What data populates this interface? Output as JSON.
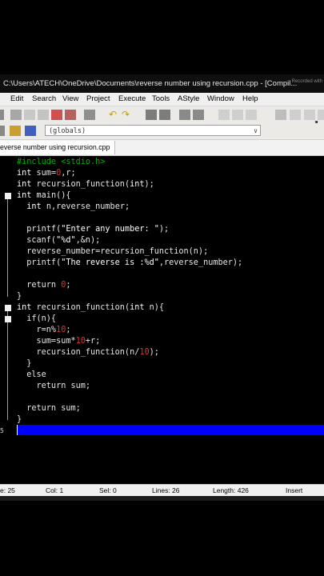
{
  "window": {
    "title": "C:\\Users\\ATECH\\OneDrive\\Documents\\reverse number using recursion.cpp - [Compil...",
    "watermark": "Recorded with"
  },
  "menu": [
    "Edit",
    "Search",
    "View",
    "Project",
    "Execute",
    "Tools",
    "AStyle",
    "Window",
    "Help"
  ],
  "scope_selector": {
    "value": "(globals)"
  },
  "tab": {
    "label": "everse number using recursion.cpp"
  },
  "code": {
    "lines": [
      [
        [
          "#include <stdio.h>",
          "pre"
        ]
      ],
      [
        [
          "int",
          "type"
        ],
        [
          " sum=",
          ""
        ],
        [
          "0",
          "num"
        ],
        [
          ",r;",
          ""
        ]
      ],
      [
        [
          "int",
          "type"
        ],
        [
          " recursion_function(",
          ""
        ],
        [
          "int",
          "type"
        ],
        [
          ");",
          ""
        ]
      ],
      [
        [
          "int",
          "type"
        ],
        [
          " main(){",
          ""
        ]
      ],
      [
        [
          "  ",
          ""
        ],
        [
          "int",
          "type"
        ],
        [
          " n,reverse_number;",
          ""
        ]
      ],
      [
        [
          "",
          ""
        ]
      ],
      [
        [
          "  printf(",
          ""
        ],
        [
          "\"Enter any number: \"",
          "str"
        ],
        [
          ");",
          ""
        ]
      ],
      [
        [
          "  scanf(",
          ""
        ],
        [
          "\"%d\"",
          "str"
        ],
        [
          ",&n);",
          ""
        ]
      ],
      [
        [
          "  reverse_number=recursion_function(n);",
          ""
        ]
      ],
      [
        [
          "  printf(",
          ""
        ],
        [
          "\"The reverse is :%d\"",
          "str"
        ],
        [
          ",reverse_number);",
          ""
        ]
      ],
      [
        [
          "",
          ""
        ]
      ],
      [
        [
          "  return ",
          ""
        ],
        [
          "0",
          "num"
        ],
        [
          ";",
          ""
        ]
      ],
      [
        [
          "}",
          ""
        ]
      ],
      [
        [
          "int",
          "type"
        ],
        [
          " recursion_function(",
          ""
        ],
        [
          "int",
          "type"
        ],
        [
          " n){",
          ""
        ]
      ],
      [
        [
          "  if(n){",
          ""
        ]
      ],
      [
        [
          "    r=n%",
          ""
        ],
        [
          "10",
          "num"
        ],
        [
          ";",
          ""
        ]
      ],
      [
        [
          "    sum=sum*",
          ""
        ],
        [
          "10",
          "num"
        ],
        [
          "+r;",
          ""
        ]
      ],
      [
        [
          "    recursion_function(n/",
          ""
        ],
        [
          "10",
          "num"
        ],
        [
          ");",
          ""
        ]
      ],
      [
        [
          "  }",
          ""
        ]
      ],
      [
        [
          "  else",
          ""
        ]
      ],
      [
        [
          "    return sum;",
          ""
        ]
      ],
      [
        [
          "",
          ""
        ]
      ],
      [
        [
          "  return sum;",
          ""
        ]
      ],
      [
        [
          "}",
          ""
        ]
      ],
      [
        [
          "",
          ""
        ]
      ]
    ],
    "gutter_numbers": [
      "",
      "",
      "",
      "",
      "",
      "",
      "",
      "",
      "",
      "",
      "",
      "",
      "",
      "",
      "",
      "",
      "",
      "",
      "",
      "",
      "",
      "",
      "",
      "",
      "5"
    ]
  },
  "status": {
    "line": "e:   25",
    "col": "Col:   1",
    "sel": "Sel:   0",
    "lines": "Lines:   26",
    "length": "Length:   426",
    "mode": "Insert"
  },
  "colors": {
    "preprocessor": "#00b000",
    "number": "#e03030",
    "selection": "#0000ff",
    "background": "#000000"
  }
}
